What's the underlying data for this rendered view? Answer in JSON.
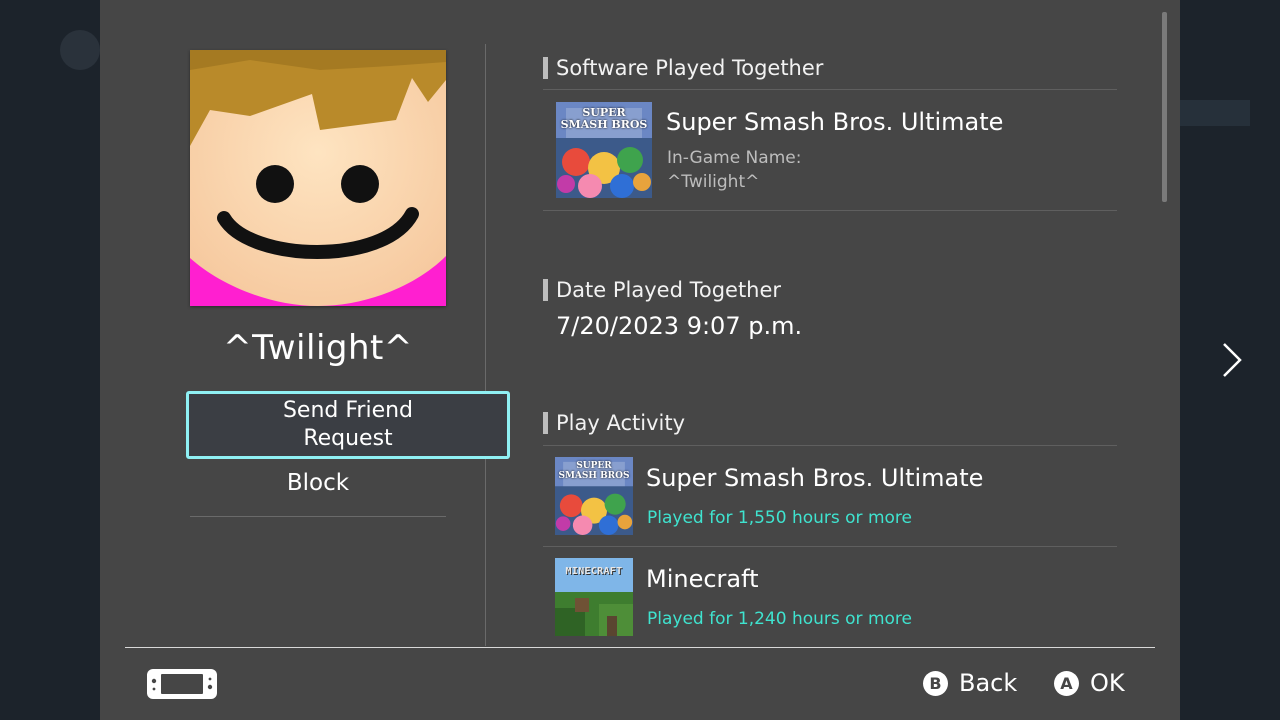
{
  "profile": {
    "username": "^Twilight^",
    "send_friend_request_label": "Send Friend Request",
    "block_label": "Block"
  },
  "software_played_together": {
    "section_title": "Software Played Together",
    "game_title": "Super Smash Bros. Ultimate",
    "ingame_name_label": "In-Game Name:",
    "ingame_name": "^Twilight^"
  },
  "date_played_together": {
    "section_title": "Date Played Together",
    "value": "7/20/2023 9:07 p.m."
  },
  "play_activity": {
    "section_title": "Play Activity",
    "items": [
      {
        "title": "Super Smash Bros. Ultimate",
        "hours": "Played for 1,550 hours or more",
        "icon": "smash-bros-cover"
      },
      {
        "title": "Minecraft",
        "hours": "Played for 1,240 hours or more",
        "icon": "minecraft-cover"
      }
    ]
  },
  "thumb_text": {
    "smash_line1": "SUPER",
    "smash_line2": "SMASH BROS",
    "minecraft": "MINECRAFT"
  },
  "footer": {
    "back_button_glyph": "B",
    "back_label": "Back",
    "ok_button_glyph": "A",
    "ok_label": "OK"
  },
  "colors": {
    "panel": "#464646",
    "focus_border": "#8ff0f4",
    "play_time": "#3fe3cf",
    "avatar_skin": "#fddcb3",
    "avatar_hair": "#b98a2a",
    "avatar_shirt": "#ff1fd0"
  }
}
